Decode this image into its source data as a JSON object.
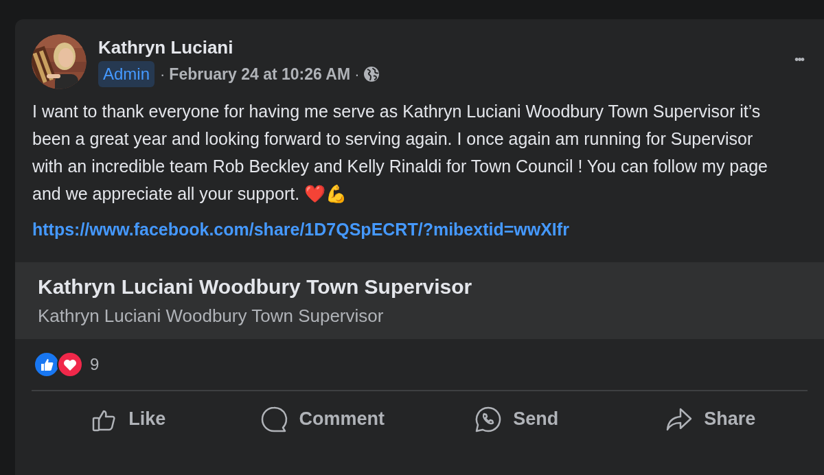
{
  "post": {
    "author": "Kathryn Luciani",
    "badge": "Admin",
    "timestamp": "February 24 at 10:26 AM",
    "separator_1": "·",
    "separator_2": "·",
    "more": "•••",
    "body": "I want to thank everyone for having me serve as Kathryn Luciani Woodbury Town Supervisor it’s been a great year and looking forward to serving again. I once again am running for Supervisor with an incredible team  Rob Beckley and Kelly Rinaldi for Town Council ! You can follow my page and we appreciate all your support. ❤️💪",
    "link": "https://www.facebook.com/share/1D7QSpECRT/?mibextid=wwXIfr",
    "preview": {
      "title": "Kathryn Luciani Woodbury Town Supervisor",
      "subtitle": "Kathryn Luciani Woodbury Town Supervisor"
    },
    "reactions": {
      "count": "9"
    },
    "actions": [
      {
        "kind": "like",
        "label": "Like"
      },
      {
        "kind": "comment",
        "label": "Comment"
      },
      {
        "kind": "send",
        "label": "Send"
      },
      {
        "kind": "share",
        "label": "Share"
      }
    ]
  }
}
